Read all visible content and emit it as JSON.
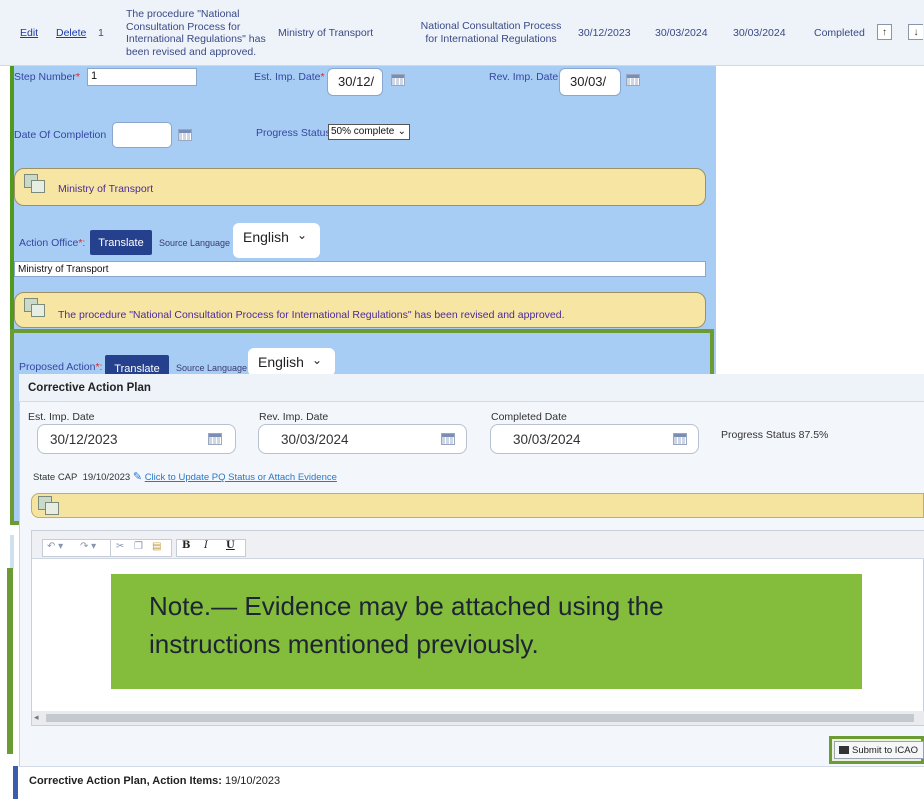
{
  "top_row": {
    "edit_link": "Edit",
    "delete_link": "Delete",
    "step_number": "1",
    "description_lines": [
      "The procedure \"National",
      "Consultation Process for",
      "International Regulations\" has",
      "been revised and approved."
    ],
    "office": "Ministry of Transport",
    "title_lines": [
      "National Consultation Process",
      "for International Regulations"
    ],
    "est_date": "30/12/2023",
    "rev_date": "30/03/2024",
    "completed_date": "30/03/2024",
    "status": "Completed",
    "move_up": "↑",
    "move_down": "↓"
  },
  "step_form": {
    "step_number_label": "Step Number",
    "required_mark": "*",
    "step_number_value": "1",
    "est_imp_label": "Est. Imp. Date",
    "est_imp_value": "30/12/",
    "rev_imp_label": "Rev. Imp. Date",
    "rev_imp_value": "30/03/",
    "date_completion_label": "Date Of Completion",
    "date_completion_value": "",
    "progress_label": "Progress Status",
    "progress_value": "50% complete",
    "office_text": "Ministry of Transport",
    "action_office_label": "Action Office",
    "action_office_suffix": "*:",
    "translate_label": "Translate",
    "source_language_label": "Source Language",
    "language_value": "English",
    "action_office_input": "Ministry of Transport",
    "proposed_text": "The procedure \"National Consultation Process for International Regulations\" has been revised and approved.",
    "proposed_action_label": "Proposed Action",
    "proposed_translate_label": "Translate",
    "proposed_source_language_label": "Source Language",
    "proposed_language_value": "English"
  },
  "cap": {
    "title": "Corrective Action Plan",
    "est_label": "Est. Imp. Date",
    "est_value": "30/12/2023",
    "rev_label": "Rev. Imp. Date",
    "rev_value": "30/03/2024",
    "completed_label": "Completed Date",
    "completed_value": "30/03/2024",
    "progress_text": "Progress Status 87.5%",
    "state_cap_label": "State CAP",
    "state_cap_date": "19/10/2023",
    "update_link": "Click to Update PQ Status or Attach Evidence"
  },
  "editor": {
    "tools": [
      "undo",
      "redo",
      "cut",
      "copy",
      "paste",
      "bold",
      "italic",
      "underline"
    ],
    "bold_label": "B",
    "italic_label": "I",
    "underline_label": "U"
  },
  "note": {
    "line1": "Note.— Evidence may be attached using the",
    "line2": "instructions mentioned previously."
  },
  "submit_label": "Submit to ICAO",
  "footer": {
    "label": "Corrective Action Plan, Action Items:",
    "date": "19/10/2023"
  },
  "colors": {
    "accent_green": "#6c9a33",
    "note_green": "#84bd3c",
    "panel_blue": "#a7cdf5",
    "translate_blue": "#25418d",
    "yellow": "#f7e6a3"
  }
}
